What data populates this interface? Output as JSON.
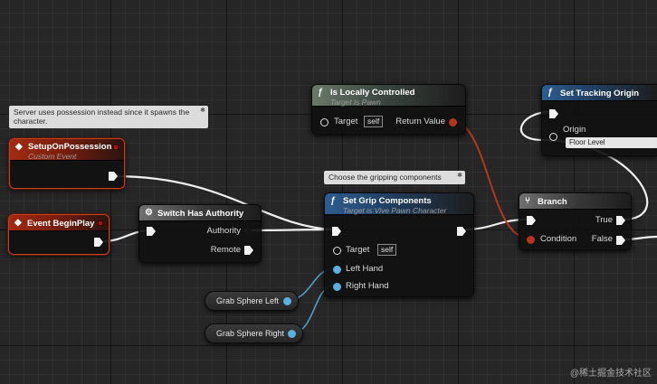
{
  "comments": {
    "possession": "Server uses possession instead since it spawns the character.",
    "gripping": "Choose the gripping components"
  },
  "nodes": {
    "setup_on_possession": {
      "title": "SetupOnPossession",
      "subtitle": "Custom Event"
    },
    "event_begin_play": {
      "title": "Event BeginPlay"
    },
    "switch_has_authority": {
      "title": "Switch Has Authority",
      "authority": "Authority",
      "remote": "Remote"
    },
    "is_locally_controlled": {
      "title": "Is Locally Controlled",
      "subtitle": "Target is Pawn",
      "target": "Target",
      "self": "self",
      "return_value": "Return Value"
    },
    "set_grip_components": {
      "title": "Set Grip Components",
      "subtitle": "Target is Vive Pawn Character",
      "target": "Target",
      "self": "self",
      "left_hand": "Left Hand",
      "right_hand": "Right Hand"
    },
    "branch": {
      "title": "Branch",
      "condition": "Condition",
      "true_label": "True",
      "false_label": "False"
    },
    "set_tracking_origin": {
      "title": "Set Tracking Origin",
      "origin": "Origin",
      "origin_value": "Floor Level"
    },
    "grab_sphere_left": {
      "title": "Grab Sphere Left"
    },
    "grab_sphere_right": {
      "title": "Grab Sphere Right"
    }
  },
  "icons": {
    "event": "diamond-icon",
    "function": "function-icon",
    "switch": "switch-icon",
    "branch": "branch-icon"
  },
  "colors": {
    "exec_wire": "#f0f0f0",
    "bool_wire": "#b3361c",
    "object_wire": "#5ab0e0",
    "event_header": "#a32a12",
    "function_header": "#2d5d91"
  },
  "watermark": "@稀土掘金技术社区"
}
